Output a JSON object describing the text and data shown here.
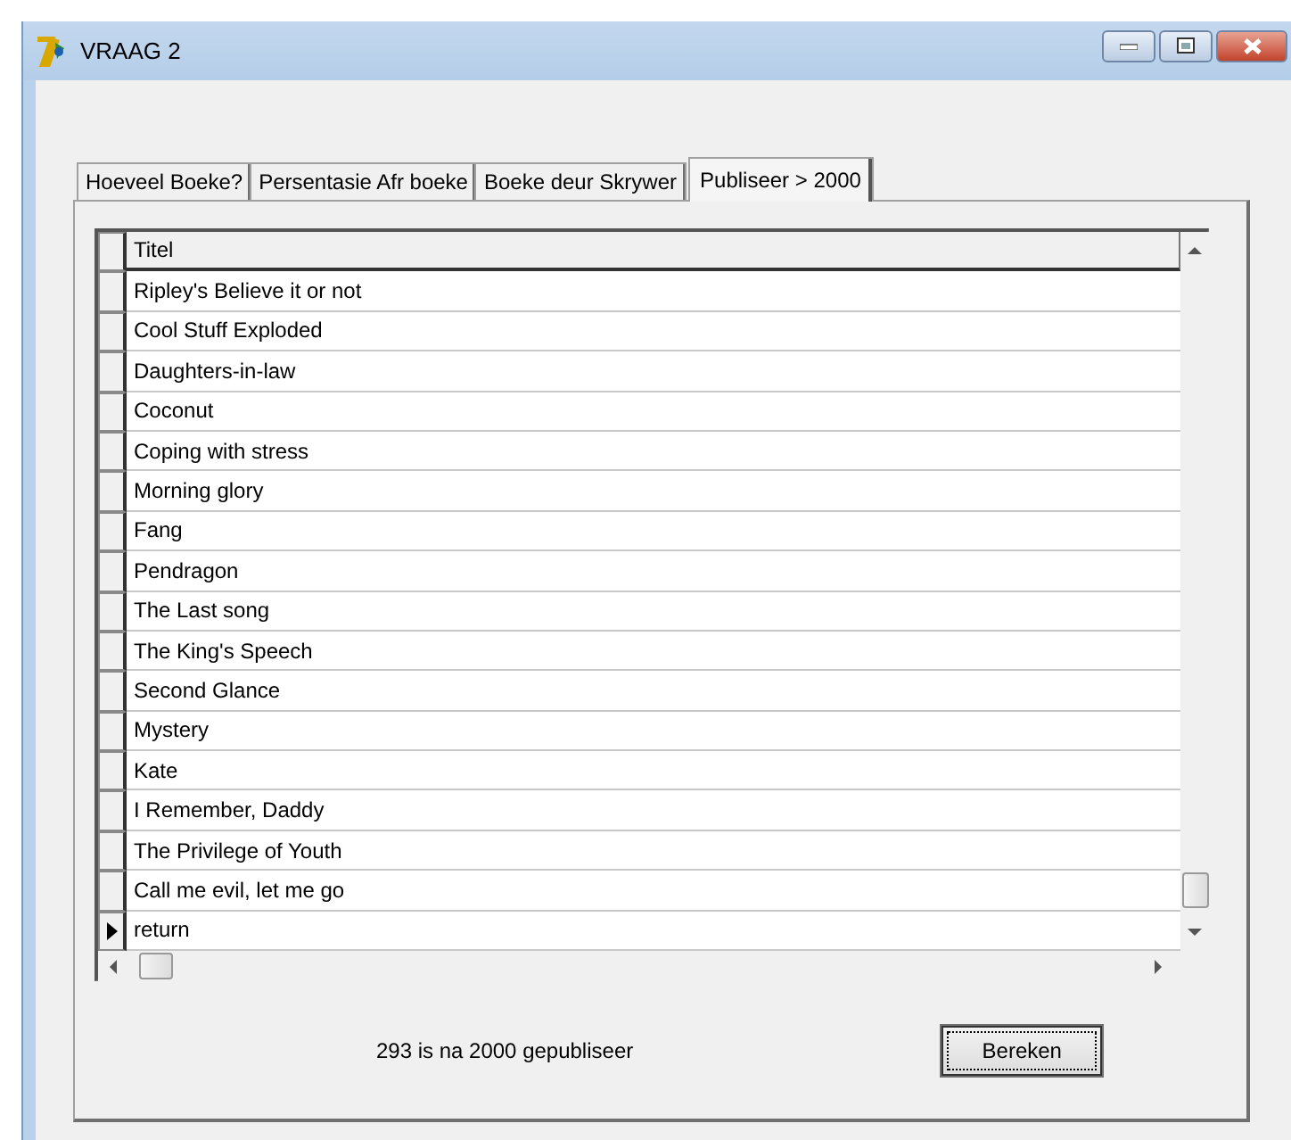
{
  "window": {
    "title": "VRAAG 2"
  },
  "tabs": [
    {
      "label": "Hoeveel Boeke?",
      "selected": false
    },
    {
      "label": "Persentasie Afr boeke",
      "selected": false
    },
    {
      "label": "Boeke deur Skrywer",
      "selected": false
    },
    {
      "label": "Publiseer > 2000",
      "selected": true
    }
  ],
  "table": {
    "columns": [
      "Titel"
    ],
    "rows": [
      {
        "cells": [
          "Ripley's Believe it or not"
        ],
        "selected": false
      },
      {
        "cells": [
          "Cool Stuff Exploded"
        ],
        "selected": false
      },
      {
        "cells": [
          "Daughters-in-law"
        ],
        "selected": false
      },
      {
        "cells": [
          "Coconut"
        ],
        "selected": false
      },
      {
        "cells": [
          "Coping with stress"
        ],
        "selected": false
      },
      {
        "cells": [
          "Morning glory"
        ],
        "selected": false
      },
      {
        "cells": [
          "Fang"
        ],
        "selected": false
      },
      {
        "cells": [
          "Pendragon"
        ],
        "selected": false
      },
      {
        "cells": [
          "The Last song"
        ],
        "selected": false
      },
      {
        "cells": [
          "The King's Speech"
        ],
        "selected": false
      },
      {
        "cells": [
          "Second Glance"
        ],
        "selected": false
      },
      {
        "cells": [
          "Mystery"
        ],
        "selected": false
      },
      {
        "cells": [
          "Kate"
        ],
        "selected": false
      },
      {
        "cells": [
          "I Remember, Daddy"
        ],
        "selected": false
      },
      {
        "cells": [
          "The Privilege of Youth"
        ],
        "selected": false
      },
      {
        "cells": [
          "Call me evil, let me go"
        ],
        "selected": false
      },
      {
        "cells": [
          "return"
        ],
        "selected": true
      }
    ]
  },
  "result_label": "293 is na 2000 gepubliseer",
  "buttons": [
    "Bereken"
  ]
}
